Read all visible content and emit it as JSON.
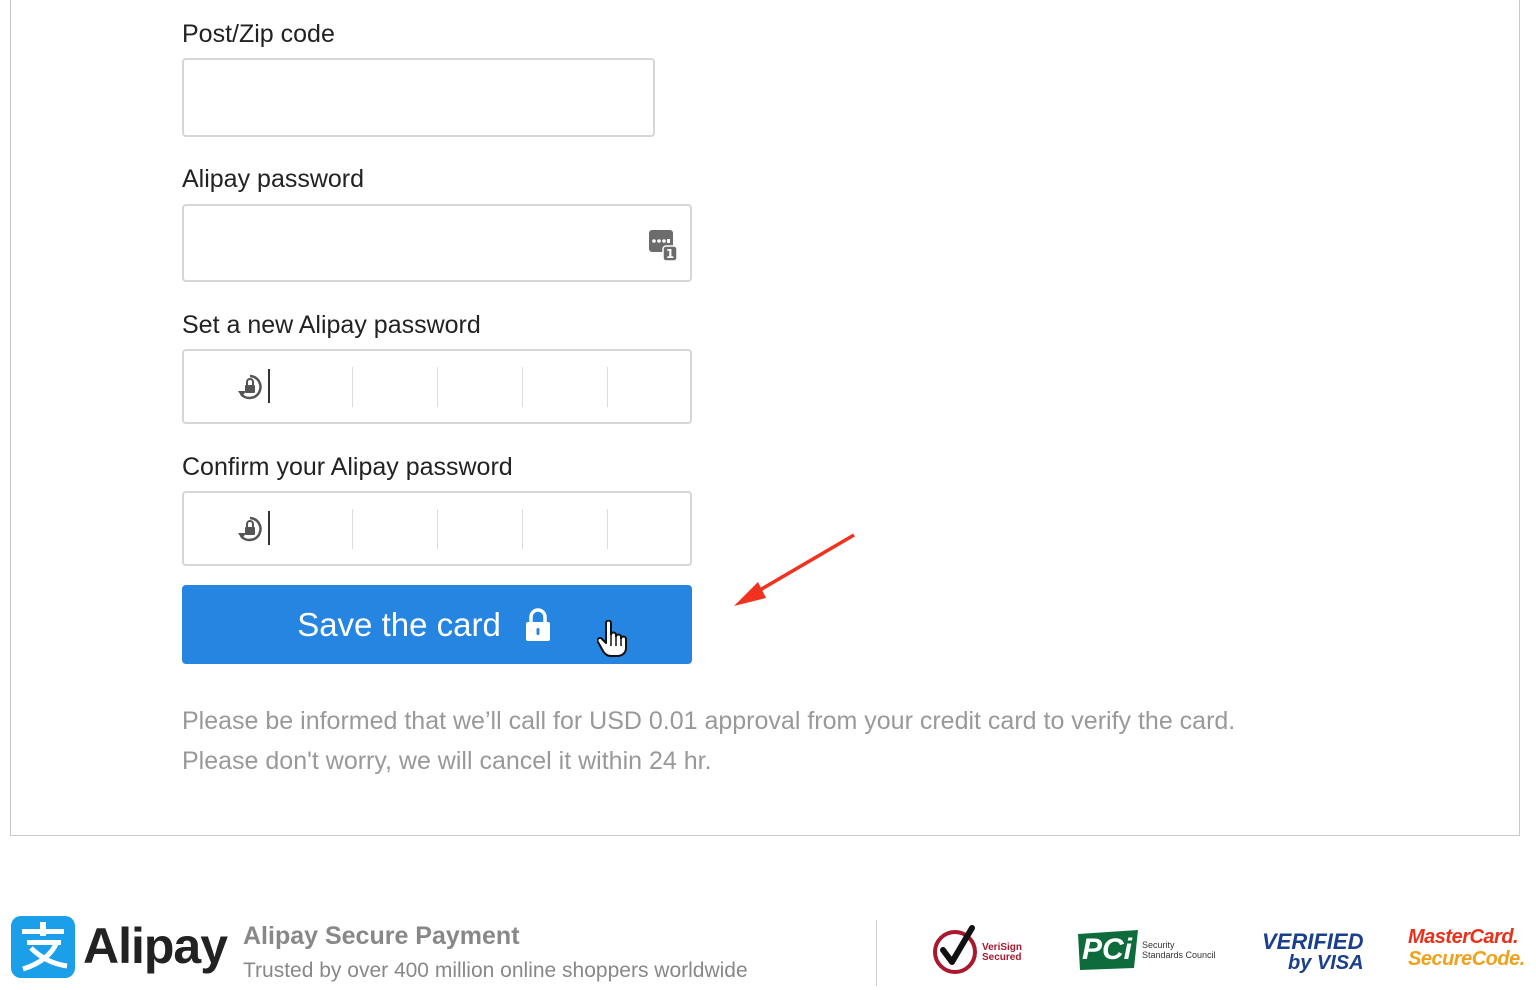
{
  "form": {
    "postcode": {
      "label": "Post/Zip code",
      "value": "",
      "placeholder": ""
    },
    "alipay_password": {
      "label": "Alipay password",
      "value": ""
    },
    "new_password": {
      "label": "Set a new Alipay password"
    },
    "confirm_password": {
      "label": "Confirm your Alipay password"
    },
    "save_button": {
      "label": "Save the card"
    },
    "notice": [
      "Please be informed that we’ll call for USD 0.01 approval from your credit card to verify the card.",
      "Please don't worry, we will cancel it within 24 hr."
    ]
  },
  "footer": {
    "brand": "Alipay",
    "secure_title": "Alipay Secure Payment",
    "secure_subtitle": "Trusted by over 400 million online shoppers worldwide",
    "badges": {
      "verisign": {
        "line1": "VeriSign",
        "line2": "Secured"
      },
      "pci": {
        "mark": "PCi",
        "line1": "Security",
        "line2": "Standards Council"
      },
      "visa": {
        "line1": "VERIFIED",
        "line2": "by VISA"
      },
      "mastercard": {
        "line1": "MasterCard.",
        "line2": "SecureCode."
      }
    }
  },
  "colors": {
    "primary_button": "#2685e0",
    "annotation_arrow": "#f0321e",
    "mastercard_red": "#e8311b",
    "visa_blue": "#1a3f8c"
  },
  "icons": {
    "password_keyboard": "password-keyboard-icon",
    "pin_lock": "refresh-lock-icon",
    "button_lock": "padlock-icon",
    "cursor": "hand-pointer-icon"
  }
}
